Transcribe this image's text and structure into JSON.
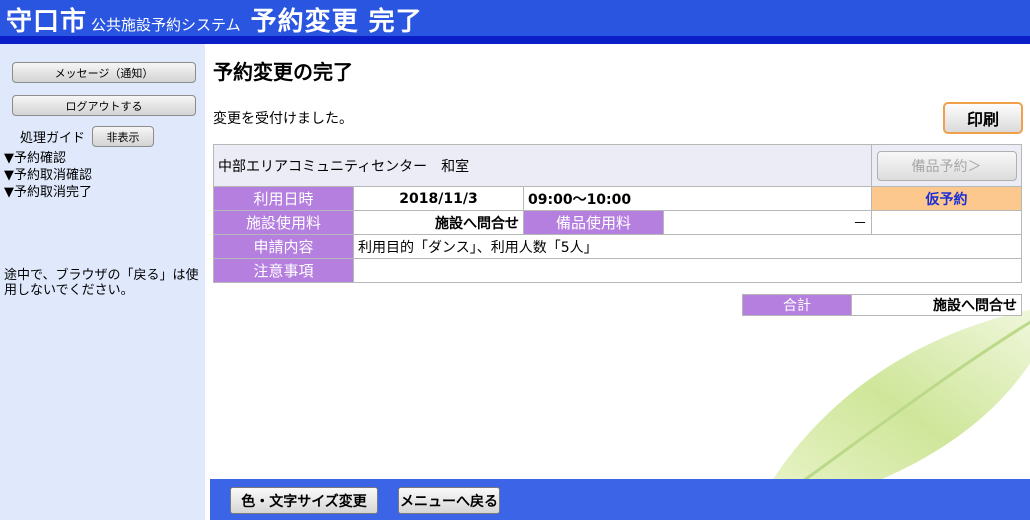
{
  "header": {
    "city": "守口市",
    "system": "公共施設予約システム",
    "page": "予約変更 完了"
  },
  "sidebar": {
    "message_button": "メッセージ（通知）",
    "logout_button": "ログアウトする",
    "guide_label": "処理ガイド",
    "guide_hide_button": "非表示",
    "guide_items": [
      "▼予約確認",
      "▼予約取消確認",
      "▼予約取消完了"
    ],
    "notice": "途中で、ブラウザの「戻る」は使用しないでください。"
  },
  "main": {
    "title": "予約変更の完了",
    "message": "変更を受付けました。",
    "print_button": "印刷",
    "facility": "中部エリアコミュニティセンター　和室",
    "equipment_button": "備品予約＞",
    "rows": {
      "datetime_label": "利用日時",
      "date": "2018/11/3",
      "time": "09:00～10:00",
      "status": "仮予約",
      "fee_label": "施設使用料",
      "fee_value": "施設へ問合せ",
      "equip_fee_label": "備品使用料",
      "equip_fee_value": "－",
      "content_label": "申請内容",
      "content_value": "利用目的「ダンス」、利用人数「5人」",
      "notes_label": "注意事項",
      "notes_value": ""
    },
    "total_label": "合計",
    "total_value": "施設へ問合せ"
  },
  "bottom": {
    "color_size_button": "色・文字サイズ変更",
    "menu_button": "メニューへ戻る"
  },
  "colors": {
    "header_bg": "#2a55e0",
    "header_line": "#0a1fc8",
    "sidebar_bg": "#dfe9fb",
    "label_purple": "#b57fe0",
    "status_bg": "#fdc88e",
    "print_border": "#f0a04a",
    "bottom_bar": "#3c64e6"
  }
}
